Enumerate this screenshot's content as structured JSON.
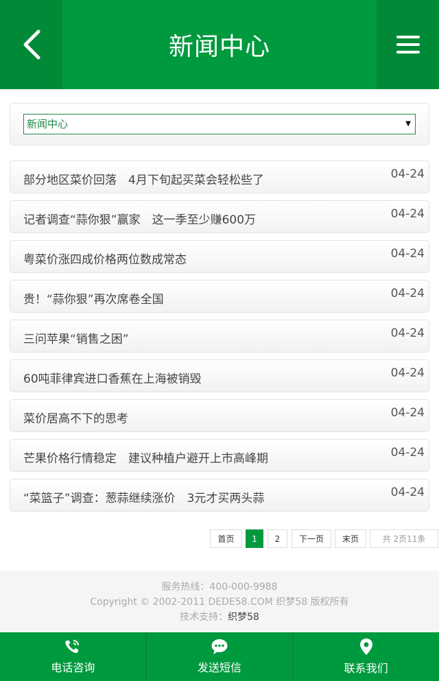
{
  "header": {
    "title": "新闻中心",
    "back_icon": "chevron-left-icon",
    "menu_icon": "menu-icon"
  },
  "category_select": {
    "selected": "新闻中心"
  },
  "news": [
    {
      "title": "部分地区菜价回落　4月下旬起买菜会轻松些了",
      "date": "04-24"
    },
    {
      "title": "记者调查“蒜你狠”赢家　这一季至少赚600万",
      "date": "04-24"
    },
    {
      "title": "粤菜价涨四成价格两位数成常态",
      "date": "04-24"
    },
    {
      "title": "贵！“蒜你狠”再次席卷全国",
      "date": "04-24"
    },
    {
      "title": "三问苹果“销售之困”",
      "date": "04-24"
    },
    {
      "title": "60吨菲律宾进口香蕉在上海被销毁",
      "date": "04-24"
    },
    {
      "title": "菜价居高不下的思考",
      "date": "04-24"
    },
    {
      "title": "芒果价格行情稳定　建议种植户避开上市高峰期",
      "date": "04-24"
    },
    {
      "title": "“菜篮子”调查：葱蒜继续涨价　3元才买两头蒜",
      "date": "04-24"
    }
  ],
  "pagination": {
    "first": "首页",
    "page1": "1",
    "page2": "2",
    "next": "下一页",
    "last": "末页",
    "info": "共 2页11条"
  },
  "footer": {
    "hotline": "服务热线：400-000-9988",
    "copyright": "Copyright © 2002-2011 DEDE58.COM 织梦58 版权所有",
    "support_label": "技术支持：",
    "support_name": "织梦58"
  },
  "bottom_nav": [
    {
      "label": "电话咨询",
      "icon": "phone-icon"
    },
    {
      "label": "发送短信",
      "icon": "message-icon"
    },
    {
      "label": "联系我们",
      "icon": "location-pin-icon"
    }
  ],
  "colors": {
    "primary": "#009a3e",
    "primary_dark": "#008a37"
  }
}
